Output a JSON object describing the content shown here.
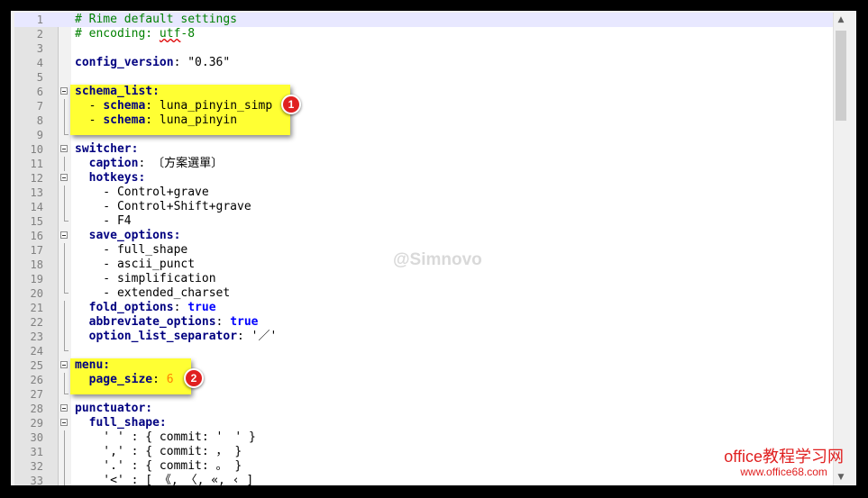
{
  "editor": {
    "lines": [
      {
        "n": "1",
        "fold": "none",
        "current": true,
        "segs": [
          {
            "c": "c-comment",
            "t": "# Rime default settings"
          }
        ]
      },
      {
        "n": "2",
        "fold": "none",
        "segs": [
          {
            "c": "c-comment",
            "t": "# encoding: "
          },
          {
            "c": "c-comment squiggle",
            "t": "utf"
          },
          {
            "c": "c-comment",
            "t": "-8"
          }
        ]
      },
      {
        "n": "3",
        "fold": "none",
        "segs": []
      },
      {
        "n": "4",
        "fold": "none",
        "segs": [
          {
            "c": "c-key",
            "t": "config_version"
          },
          {
            "c": "c-plain",
            "t": ": \"0.36\""
          }
        ]
      },
      {
        "n": "5",
        "fold": "none",
        "segs": []
      },
      {
        "n": "6",
        "fold": "open",
        "segs": [
          {
            "c": "c-key",
            "t": "schema_list:"
          }
        ]
      },
      {
        "n": "7",
        "fold": "line",
        "segs": [
          {
            "c": "c-plain",
            "t": "  - "
          },
          {
            "c": "c-key",
            "t": "schema"
          },
          {
            "c": "c-plain",
            "t": ": luna_pinyin_simp"
          }
        ]
      },
      {
        "n": "8",
        "fold": "line",
        "segs": [
          {
            "c": "c-plain",
            "t": "  - "
          },
          {
            "c": "c-key",
            "t": "schema"
          },
          {
            "c": "c-plain",
            "t": ": luna_pinyin"
          }
        ]
      },
      {
        "n": "9",
        "fold": "end",
        "segs": []
      },
      {
        "n": "10",
        "fold": "open",
        "segs": [
          {
            "c": "c-key",
            "t": "switcher:"
          }
        ]
      },
      {
        "n": "11",
        "fold": "line",
        "segs": [
          {
            "c": "c-plain",
            "t": "  "
          },
          {
            "c": "c-key",
            "t": "caption"
          },
          {
            "c": "c-plain",
            "t": ": 〔方案選單〕"
          }
        ]
      },
      {
        "n": "12",
        "fold": "open",
        "segs": [
          {
            "c": "c-plain",
            "t": "  "
          },
          {
            "c": "c-key",
            "t": "hotkeys:"
          }
        ]
      },
      {
        "n": "13",
        "fold": "line",
        "segs": [
          {
            "c": "c-plain",
            "t": "    - Control+grave"
          }
        ]
      },
      {
        "n": "14",
        "fold": "line",
        "segs": [
          {
            "c": "c-plain",
            "t": "    - Control+Shift+grave"
          }
        ]
      },
      {
        "n": "15",
        "fold": "end",
        "segs": [
          {
            "c": "c-plain",
            "t": "    - F4"
          }
        ]
      },
      {
        "n": "16",
        "fold": "open",
        "segs": [
          {
            "c": "c-plain",
            "t": "  "
          },
          {
            "c": "c-key",
            "t": "save_options:"
          }
        ]
      },
      {
        "n": "17",
        "fold": "line",
        "segs": [
          {
            "c": "c-plain",
            "t": "    - full_shape"
          }
        ]
      },
      {
        "n": "18",
        "fold": "line",
        "segs": [
          {
            "c": "c-plain",
            "t": "    - ascii_punct"
          }
        ]
      },
      {
        "n": "19",
        "fold": "line",
        "segs": [
          {
            "c": "c-plain",
            "t": "    - simplification"
          }
        ]
      },
      {
        "n": "20",
        "fold": "end",
        "segs": [
          {
            "c": "c-plain",
            "t": "    - extended_charset"
          }
        ]
      },
      {
        "n": "21",
        "fold": "line",
        "segs": [
          {
            "c": "c-plain",
            "t": "  "
          },
          {
            "c": "c-key",
            "t": "fold_options"
          },
          {
            "c": "c-plain",
            "t": ": "
          },
          {
            "c": "c-bool",
            "t": "true"
          }
        ]
      },
      {
        "n": "22",
        "fold": "line",
        "segs": [
          {
            "c": "c-plain",
            "t": "  "
          },
          {
            "c": "c-key",
            "t": "abbreviate_options"
          },
          {
            "c": "c-plain",
            "t": ": "
          },
          {
            "c": "c-bool",
            "t": "true"
          }
        ]
      },
      {
        "n": "23",
        "fold": "line",
        "segs": [
          {
            "c": "c-plain",
            "t": "  "
          },
          {
            "c": "c-key",
            "t": "option_list_separator"
          },
          {
            "c": "c-plain",
            "t": ": '／'"
          }
        ]
      },
      {
        "n": "24",
        "fold": "end",
        "segs": []
      },
      {
        "n": "25",
        "fold": "open",
        "segs": [
          {
            "c": "c-key",
            "t": "menu:"
          }
        ]
      },
      {
        "n": "26",
        "fold": "line",
        "segs": [
          {
            "c": "c-plain",
            "t": "  "
          },
          {
            "c": "c-key",
            "t": "page_size"
          },
          {
            "c": "c-plain",
            "t": ": "
          },
          {
            "c": "c-num",
            "t": "6"
          }
        ]
      },
      {
        "n": "27",
        "fold": "end",
        "segs": []
      },
      {
        "n": "28",
        "fold": "open",
        "segs": [
          {
            "c": "c-key",
            "t": "punctuator:"
          }
        ]
      },
      {
        "n": "29",
        "fold": "open",
        "segs": [
          {
            "c": "c-plain",
            "t": "  "
          },
          {
            "c": "c-key",
            "t": "full_shape:"
          }
        ]
      },
      {
        "n": "30",
        "fold": "line",
        "segs": [
          {
            "c": "c-plain",
            "t": "    ' ' : { commit: '　' }"
          }
        ]
      },
      {
        "n": "31",
        "fold": "line",
        "segs": [
          {
            "c": "c-plain",
            "t": "    ',' : { commit: ， }"
          }
        ]
      },
      {
        "n": "32",
        "fold": "line",
        "segs": [
          {
            "c": "c-plain",
            "t": "    '.' : { commit: 。 }"
          }
        ]
      },
      {
        "n": "33",
        "fold": "line",
        "segs": [
          {
            "c": "c-plain",
            "t": "    '<' : [ 《, 〈, «, ‹ ]"
          }
        ]
      }
    ]
  },
  "annotations": {
    "badge1": "1",
    "badge2": "2",
    "highlight_color": "#ffff33",
    "badge_color": "#e02020"
  },
  "watermark": "@Simnovo",
  "site_logo": {
    "line1": "office教程学习网",
    "line2": "www.office68.com"
  },
  "scrollbar": {
    "up_icon": "chevron-up-icon",
    "down_icon": "chevron-down-icon"
  }
}
